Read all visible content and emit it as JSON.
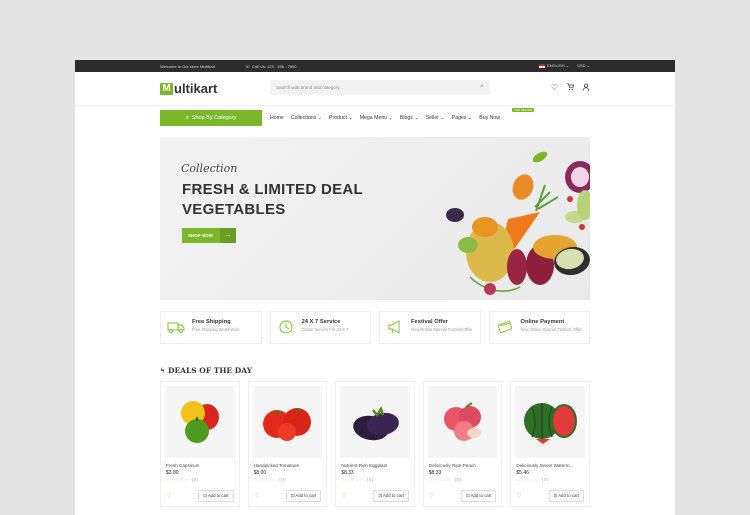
{
  "topbar": {
    "welcome": "Welcome to Our store Multikart",
    "call": "Call Us: 123 - 456 - 7890",
    "language": "ENGLISH",
    "currency": "USD"
  },
  "header": {
    "logo_letter": "M",
    "logo_rest": "ultikart",
    "search_placeholder": "Search with brand and category..."
  },
  "nav": {
    "category_button": "Shop By Category",
    "items": [
      "Home",
      "Collections",
      "Product",
      "Mega Menu",
      "Blogs",
      "Seller",
      "Pages",
      "Buy Now"
    ],
    "new_tag": "TOP SELLER"
  },
  "hero": {
    "script": "Collection",
    "line1": "FRESH & LIMITED DEAL",
    "line2": "VEGETABLES",
    "button": "SHOP NOW"
  },
  "features": [
    {
      "title": "Free Shipping",
      "sub": "Free Shipping World Wide"
    },
    {
      "title": "24 X 7 Service",
      "sub": "Online Service For 24 X 7"
    },
    {
      "title": "Festival Offer",
      "sub": "New Online Special Festival Offer"
    },
    {
      "title": "Online Payment",
      "sub": "New Online Special Festival Offer"
    }
  ],
  "deals": {
    "title": "DEALS OF THE DAY",
    "products": [
      {
        "name": "Fresh Capsicum",
        "price": "$3.80",
        "rating": "(0)",
        "add": "Add to cart"
      },
      {
        "name": "Handpicked Tomatoes",
        "price": "$8.00",
        "rating": "(0)",
        "add": "Add to cart"
      },
      {
        "name": "Nutrient-Rich Eggplant",
        "price": "$8.33",
        "rating": "(0)",
        "add": "Add to cart"
      },
      {
        "name": "Deliciously Ripe Peach",
        "price": "$8.33",
        "rating": "(0)",
        "add": "Add to cart"
      },
      {
        "name": "Deliciously Sweet Waterm...",
        "price": "$5.46",
        "rating": "(0)",
        "add": "Add to cart"
      }
    ]
  },
  "colors": {
    "accent": "#7ab829",
    "topbar": "#2c2c2c"
  }
}
